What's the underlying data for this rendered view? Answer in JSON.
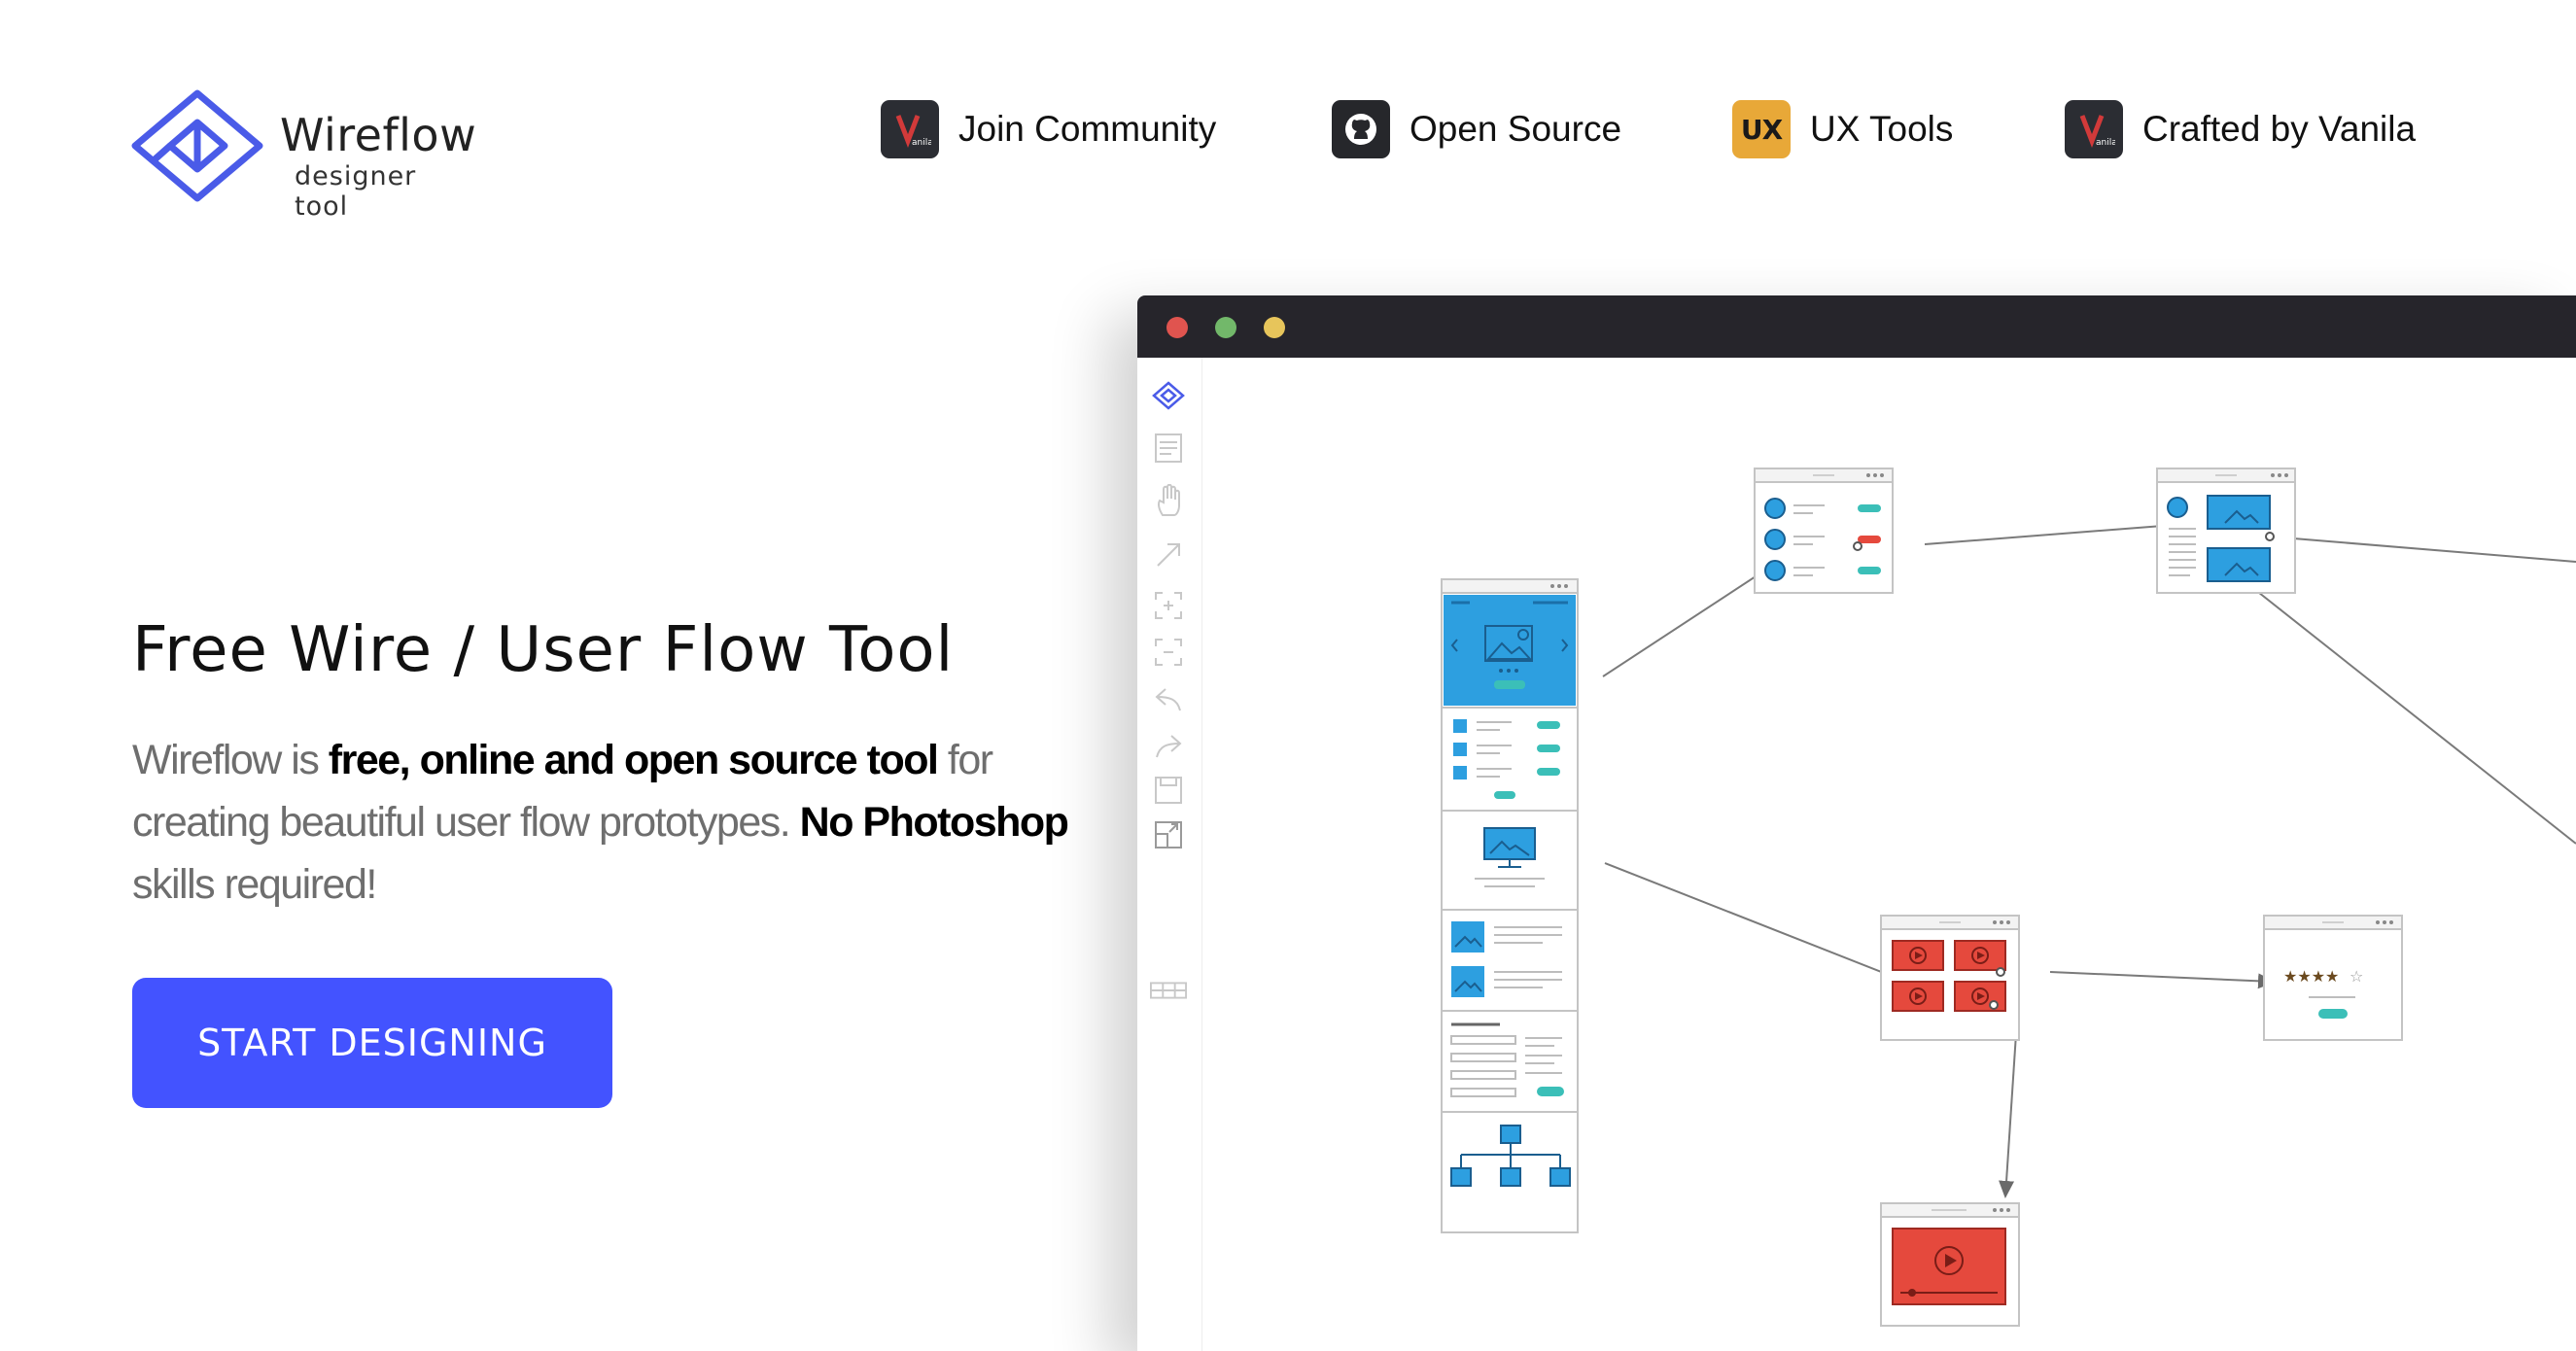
{
  "brand": {
    "name": "Wireflow",
    "tagline": "designer tool"
  },
  "nav": [
    {
      "label": "Join Community",
      "icon": "vanila-logo-icon"
    },
    {
      "label": "Open Source",
      "icon": "github-icon"
    },
    {
      "label": "UX Tools",
      "icon": "ux-tools-icon",
      "badge": "UX"
    },
    {
      "label": "Crafted by Vanila",
      "icon": "vanila-logo-icon"
    }
  ],
  "hero": {
    "title": "Free Wire / User Flow Tool",
    "desc": [
      {
        "text": "Wireflow is ",
        "bold": false
      },
      {
        "text": "free, online and open source tool",
        "bold": true
      },
      {
        "text": " for creating beautiful user flow prototypes. ",
        "bold": false
      },
      {
        "text": "No Photoshop",
        "bold": true
      },
      {
        "text": " skills required!",
        "bold": false
      }
    ],
    "cta": "START DESIGNING"
  },
  "app": {
    "toolbar_icons": [
      "wireflow-logo-icon",
      "page-icon",
      "hand-icon",
      "arrow-icon",
      "add-frame-icon",
      "remove-frame-icon",
      "undo-icon",
      "redo-icon",
      "save-icon",
      "export-icon",
      "grid-icon"
    ]
  },
  "colors": {
    "accent": "#4353ff",
    "titlebar": "#26252b",
    "wire_blue": "#2d9fe0",
    "wire_red": "#e5493d",
    "wire_teal": "#3bbfb8"
  }
}
